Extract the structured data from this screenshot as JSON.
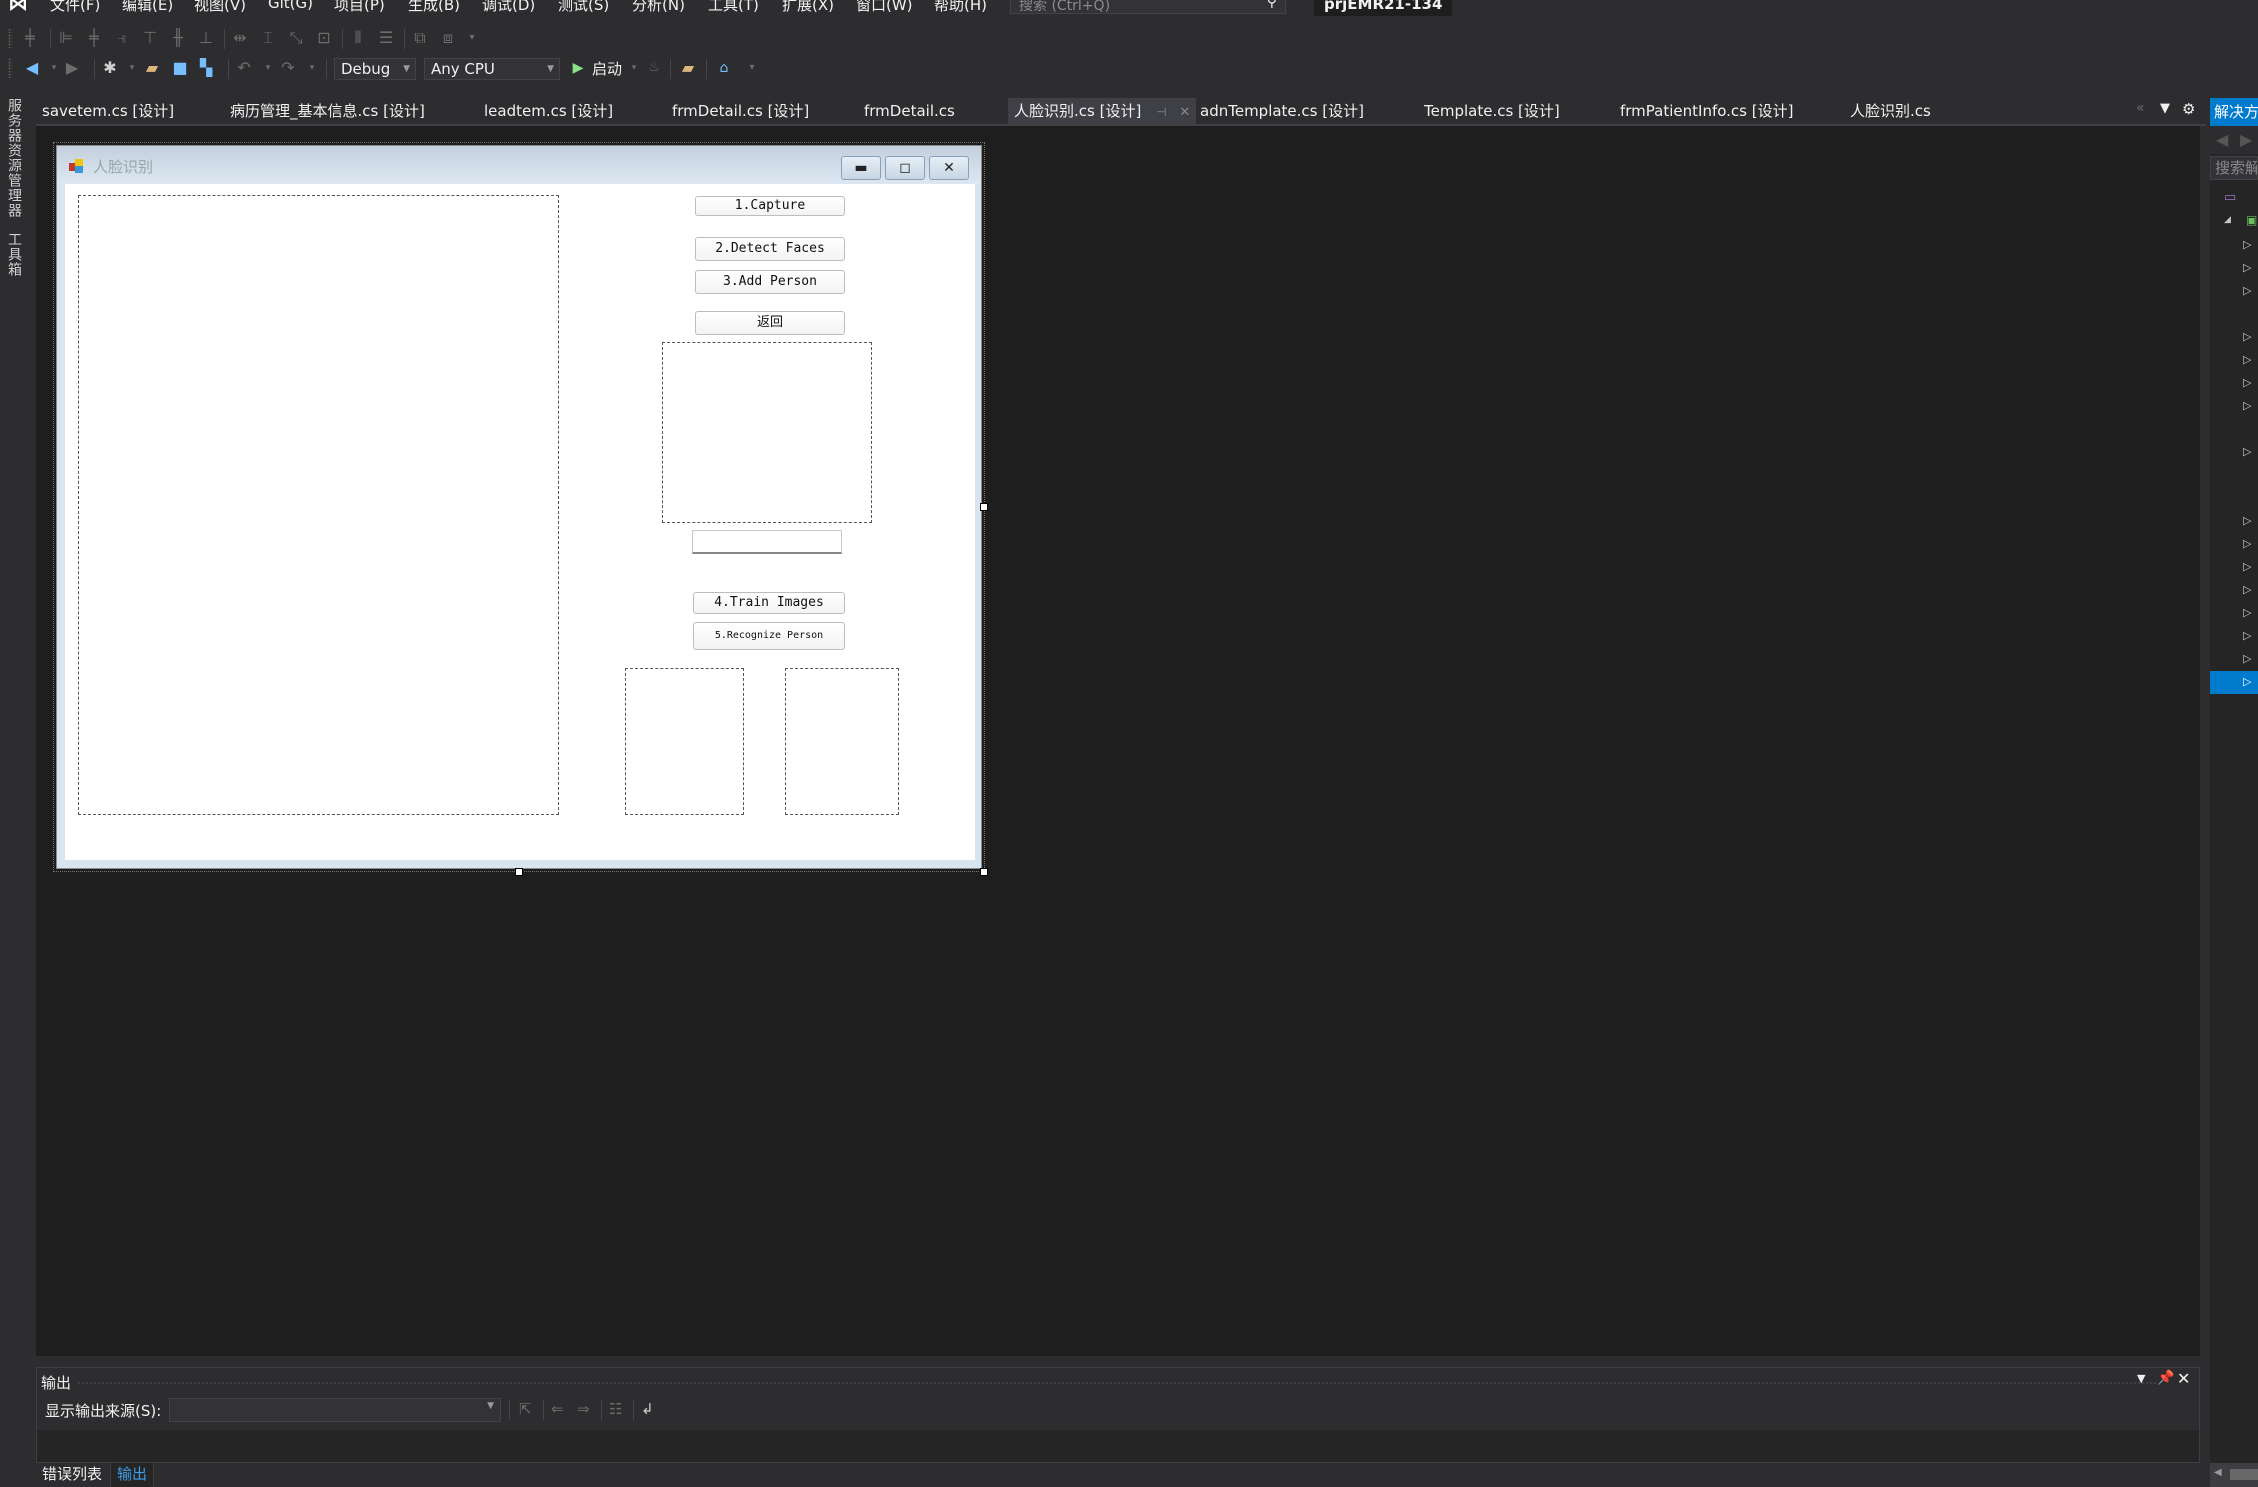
{
  "menubar": {
    "items": [
      "文件(F)",
      "编辑(E)",
      "视图(V)",
      "Git(G)",
      "项目(P)",
      "生成(B)",
      "调试(D)",
      "测试(S)",
      "分析(N)",
      "工具(T)",
      "扩展(X)",
      "窗口(W)",
      "帮助(H)"
    ],
    "search_placeholder": "搜索 (Ctrl+Q)",
    "project_name": "prjEMR21-134"
  },
  "toolbar": {
    "configuration": "Debug",
    "platform": "Any CPU",
    "start_label": "启动"
  },
  "left_strip": {
    "tabs": [
      "服务器资源管理器",
      "工具箱"
    ]
  },
  "doc_tabs": [
    {
      "label": "savetem.cs [设计]",
      "active": false
    },
    {
      "label": "病历管理_基本信息.cs [设计]",
      "active": false
    },
    {
      "label": "leadtem.cs [设计]",
      "active": false
    },
    {
      "label": "frmDetail.cs [设计]",
      "active": false
    },
    {
      "label": "frmDetail.cs",
      "active": false
    },
    {
      "label": "人脸识别.cs [设计]",
      "active": true
    },
    {
      "label": "adnTemplate.cs [设计]",
      "active": false
    },
    {
      "label": "Template.cs [设计]",
      "active": false
    },
    {
      "label": "frmPatientInfo.cs [设计]",
      "active": false
    },
    {
      "label": "人脸识别.cs",
      "active": false
    }
  ],
  "form": {
    "title": "人脸识别",
    "buttons": {
      "capture": "1.Capture",
      "detect_faces": "2.Detect Faces",
      "add_person": "3.Add Person",
      "back": "返回",
      "train_images": "4.Train Images",
      "recognize_person": "5.Recognize Person"
    },
    "name_textbox_value": ""
  },
  "output_panel": {
    "title": "输出",
    "source_label": "显示输出来源(S):",
    "source_value": ""
  },
  "bottom_tabs": [
    {
      "label": "错误列表",
      "active": false
    },
    {
      "label": "输出",
      "active": true
    }
  ],
  "solution_explorer": {
    "title": "解决方案资源管理器",
    "search_placeholder": "搜索解决方案资源管理器"
  },
  "colors": {
    "accent": "#007acc",
    "editor_bg": "#1e1e1e",
    "chrome_bg": "#2d2d30"
  }
}
